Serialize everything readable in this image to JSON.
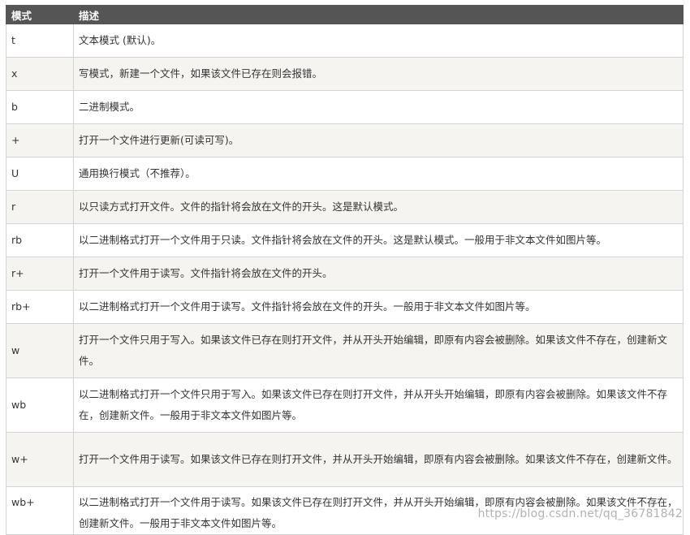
{
  "table": {
    "headers": [
      "模式",
      "描述"
    ],
    "rows": [
      {
        "mode": "t",
        "desc": "文本模式 (默认)。"
      },
      {
        "mode": "x",
        "desc": "写模式，新建一个文件，如果该文件已存在则会报错。"
      },
      {
        "mode": "b",
        "desc": "二进制模式。"
      },
      {
        "mode": "+",
        "desc": "打开一个文件进行更新(可读可写)。"
      },
      {
        "mode": "U",
        "desc": "通用换行模式（不推荐）。"
      },
      {
        "mode": "r",
        "desc": "以只读方式打开文件。文件的指针将会放在文件的开头。这是默认模式。"
      },
      {
        "mode": "rb",
        "desc": "以二进制格式打开一个文件用于只读。文件指针将会放在文件的开头。这是默认模式。一般用于非文本文件如图片等。"
      },
      {
        "mode": "r+",
        "desc": "打开一个文件用于读写。文件指针将会放在文件的开头。"
      },
      {
        "mode": "rb+",
        "desc": "以二进制格式打开一个文件用于读写。文件指针将会放在文件的开头。一般用于非文本文件如图片等。"
      },
      {
        "mode": "w",
        "desc": "打开一个文件只用于写入。如果该文件已存在则打开文件，并从开头开始编辑，即原有内容会被删除。如果该文件不存在，创建新文件。"
      },
      {
        "mode": "wb",
        "desc": "以二进制格式打开一个文件只用于写入。如果该文件已存在则打开文件，并从开头开始编辑，即原有内容会被删除。如果该文件不存在，创建新文件。一般用于非文本文件如图片等。"
      },
      {
        "mode": "w+",
        "desc": "打开一个文件用于读写。如果该文件已存在则打开文件，并从开头开始编辑，即原有内容会被删除。如果该文件不存在，创建新文件。"
      },
      {
        "mode": "wb+",
        "desc": "以二进制格式打开一个文件用于读写。如果该文件已存在则打开文件，并从开头开始编辑，即原有内容会被删除。如果该文件不存在，创建新文件。一般用于非文本文件如图片等。"
      }
    ]
  },
  "watermark": "https://blog.csdn.net/qq_36781842",
  "colors": {
    "header_bg": "#555555",
    "header_text": "#ffffff",
    "row_alt_bg": "#f6f4f0",
    "border": "#d4d4d4",
    "text": "#333333"
  }
}
